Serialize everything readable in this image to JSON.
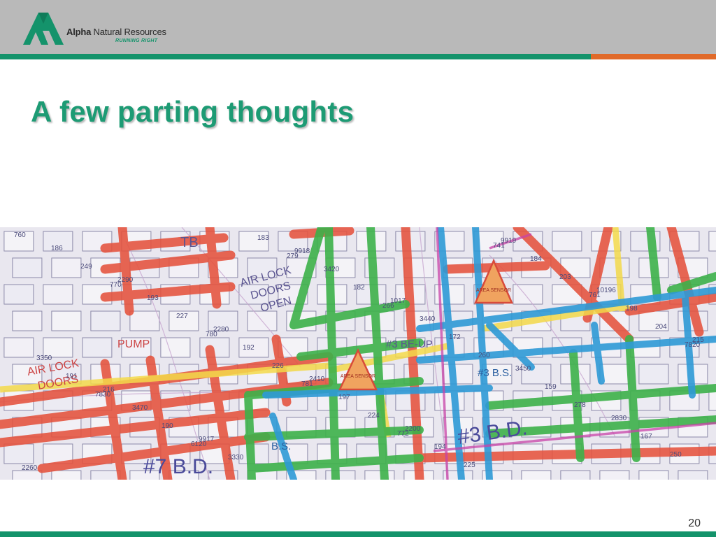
{
  "brand": {
    "name_bold": "Alpha",
    "name_regular": " Natural Resources",
    "tagline": "RUNNING RIGHT",
    "colors": {
      "green": "#14936b",
      "orange": "#e06a2a",
      "header_gray": "#b9b9b9"
    }
  },
  "slide": {
    "title": "A few parting thoughts",
    "page_number": "20"
  },
  "map": {
    "labels": {
      "tb": "TB",
      "air_lock_1": "AIR LOCK",
      "doors_open_1": "DOORS",
      "doors_open_2": "OPEN",
      "pump": "PUMP",
      "air_lock_2": "AIR LOCK",
      "doors_2": "DOORS",
      "three_be_up": "#3 BE-UP",
      "three_bs": "#3 B.S.",
      "bs": "B.S.",
      "seven_bd": "#7  B.D.",
      "three_bd": "#3 B.D.",
      "area_sensor_1": "AREA SENSOR",
      "area_sensor_2": "AREA SENSOR"
    },
    "numbers": [
      "760",
      "770",
      "780",
      "781",
      "772",
      "741",
      "761",
      "7820",
      "7830",
      "6120",
      "279",
      "266",
      "260",
      "278",
      "250",
      "249",
      "227",
      "226",
      "224",
      "225",
      "203",
      "204",
      "191",
      "190",
      "183",
      "182",
      "172",
      "159",
      "167",
      "186",
      "193",
      "192",
      "197",
      "194",
      "184",
      "198",
      "3350",
      "3470",
      "3330",
      "3420",
      "3440",
      "3450",
      "2830",
      "2260",
      "2290",
      "2280",
      "2410",
      "2200",
      "9919",
      "10196",
      "215",
      "216",
      "9917",
      "9918",
      "1017"
    ]
  }
}
